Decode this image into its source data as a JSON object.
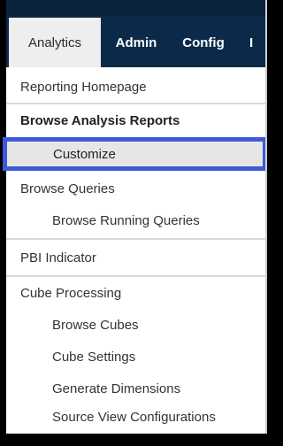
{
  "topnav": {
    "tabs": [
      {
        "label": "Analytics",
        "active": true
      },
      {
        "label": "Admin",
        "active": false
      },
      {
        "label": "Config",
        "active": false
      },
      {
        "label": "I",
        "active": false
      }
    ]
  },
  "menu": {
    "items": [
      {
        "label": "Reporting Homepage",
        "level": 0,
        "bold": false
      },
      {
        "label": "Browse Analysis Reports",
        "level": 0,
        "bold": true
      },
      {
        "label": "Customize",
        "level": 1,
        "selected": true
      },
      {
        "label": "Browse Queries",
        "level": 0,
        "bold": false
      },
      {
        "label": "Browse Running Queries",
        "level": 1
      },
      {
        "label": "PBI Indicator",
        "level": 0,
        "bold": false
      },
      {
        "label": "Cube Processing",
        "level": 0,
        "bold": false
      },
      {
        "label": "Browse Cubes",
        "level": 1
      },
      {
        "label": "Cube Settings",
        "level": 1
      },
      {
        "label": "Generate Dimensions",
        "level": 1
      },
      {
        "label": "Source View Configurations",
        "level": 1
      }
    ]
  },
  "colors": {
    "nav_background": "#0b2a4a",
    "active_tab": "#eeeeee",
    "selection_highlight": "#3f5ad8"
  }
}
